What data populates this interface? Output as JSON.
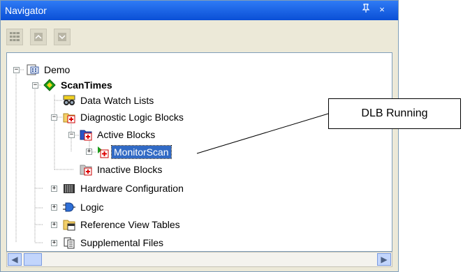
{
  "window": {
    "title": "Navigator",
    "pin_glyph": "↕",
    "close_glyph": "×"
  },
  "toolbar": {
    "items": [
      "grid-view-icon",
      "collapse-icon",
      "expand-icon"
    ]
  },
  "tree": {
    "demo": "Demo",
    "scantimes": "ScanTimes",
    "data_watch_lists": "Data Watch Lists",
    "diagnostic_logic_blocks": "Diagnostic Logic Blocks",
    "active_blocks": "Active Blocks",
    "monitor_scan": "MonitorScan",
    "inactive_blocks": "Inactive Blocks",
    "hardware_configuration": "Hardware Configuration",
    "logic": "Logic",
    "reference_view_tables": "Reference View Tables",
    "supplemental_files": "Supplemental Files"
  },
  "callout": {
    "text": "DLB Running"
  },
  "colors": {
    "titlebar": "#0a54e3",
    "selection": "#316ac5",
    "window_bg": "#ece9d8"
  }
}
